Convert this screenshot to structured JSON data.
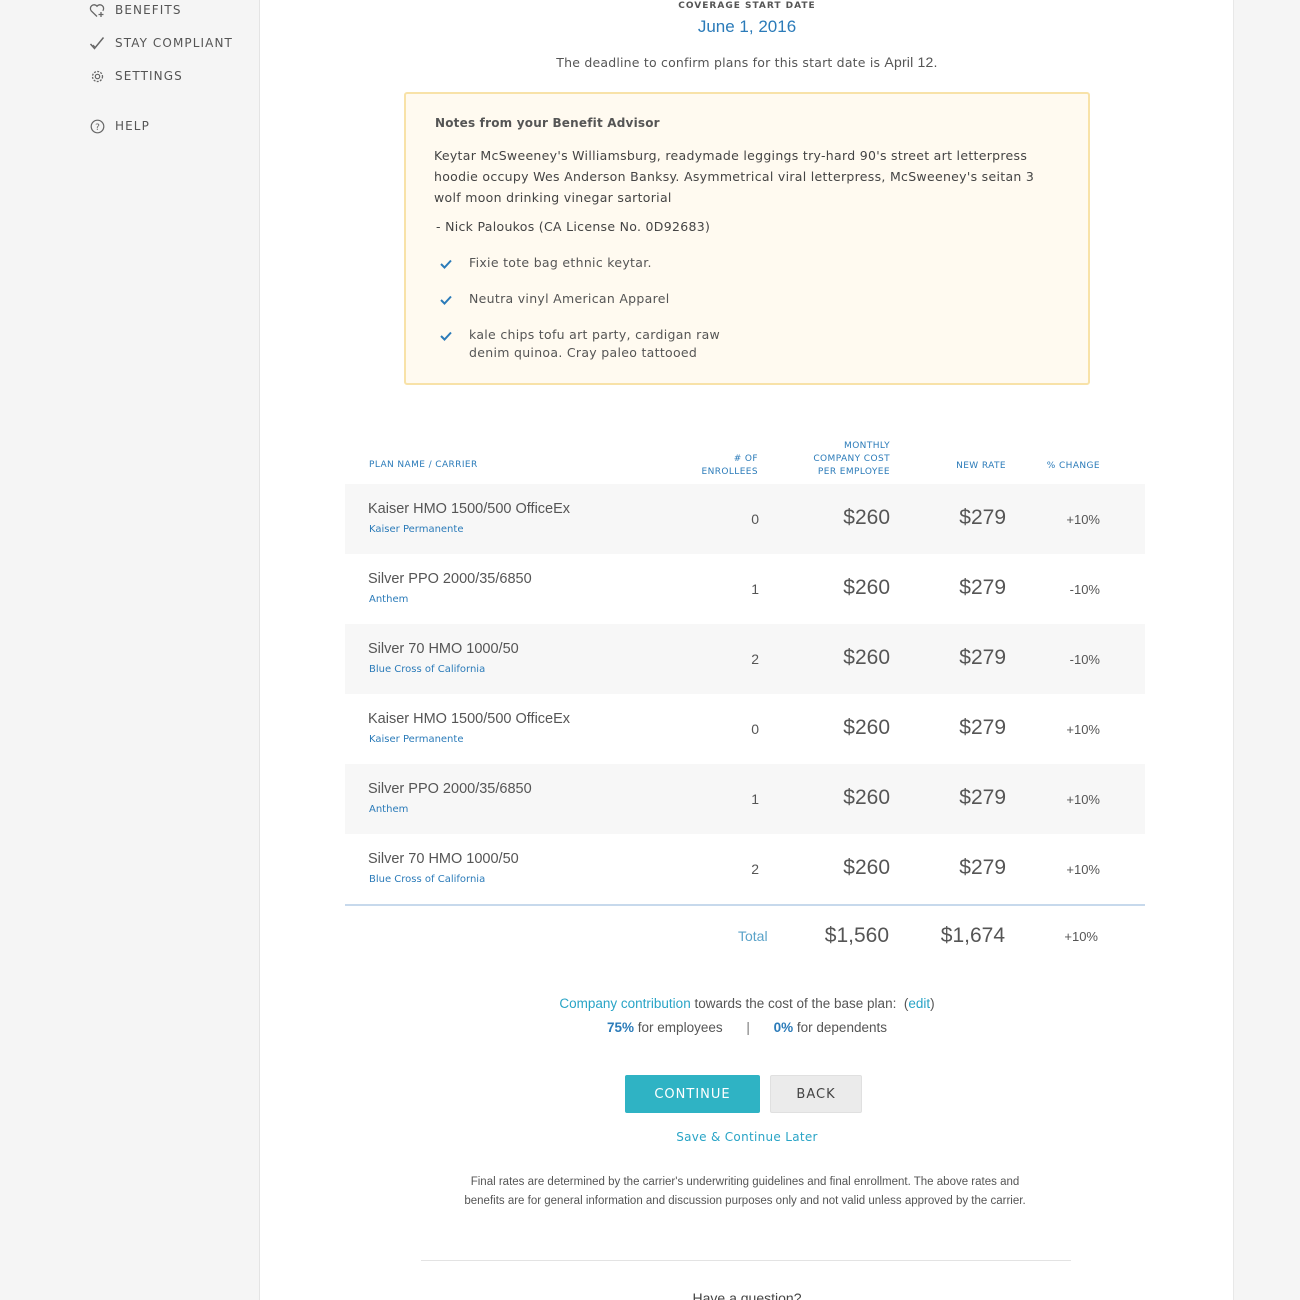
{
  "sidebar": {
    "items": [
      {
        "label": "BENEFITS",
        "icon": "heart-plus-icon"
      },
      {
        "label": "STAY COMPLIANT",
        "icon": "checkmark-icon"
      },
      {
        "label": "SETTINGS",
        "icon": "gear-icon"
      },
      {
        "label": "HELP",
        "icon": "question-circle-icon"
      }
    ]
  },
  "coverage": {
    "label": "COVERAGE START DATE",
    "date": "June 1, 2016",
    "deadline_text": "The deadline to confirm plans for this start date is",
    "deadline_date": "April 12",
    "deadline_end": "."
  },
  "notes": {
    "title": "Notes from your Benefit Advisor",
    "body": "Keytar McSweeney's Williamsburg, readymade leggings try-hard 90's street art letterpress hoodie occupy Wes Anderson Banksy. Asymmetrical viral letterpress, McSweeney's seitan 3 wolf moon drinking vinegar sartorial",
    "signature": "- Nick Paloukos (CA License No. 0D92683)",
    "checks": [
      "Fixie tote bag ethnic keytar.",
      "Neutra vinyl American Apparel",
      "kale chips tofu art party, cardigan raw denim quinoa. Cray paleo tattooed"
    ]
  },
  "table": {
    "headers": {
      "plan": "PLAN NAME / CARRIER",
      "enrollees_1": "# OF",
      "enrollees_2": "ENROLLEES",
      "cost_1": "MONTHLY",
      "cost_2": "COMPANY COST",
      "cost_3": "PER EMPLOYEE",
      "rate": "NEW RATE",
      "change": "% CHANGE"
    },
    "rows": [
      {
        "plan": "Kaiser HMO 1500/500 OfficeEx",
        "carrier": "Kaiser Permanente",
        "enrollees": "0",
        "cost": "$260",
        "rate": "$279",
        "change": "+10%"
      },
      {
        "plan": "Silver PPO 2000/35/6850",
        "carrier": "Anthem",
        "enrollees": "1",
        "cost": "$260",
        "rate": "$279",
        "change": "-10%"
      },
      {
        "plan": "Silver 70 HMO 1000/50",
        "carrier": "Blue Cross of California",
        "enrollees": "2",
        "cost": "$260",
        "rate": "$279",
        "change": "-10%"
      },
      {
        "plan": "Kaiser HMO 1500/500 OfficeEx",
        "carrier": "Kaiser Permanente",
        "enrollees": "0",
        "cost": "$260",
        "rate": "$279",
        "change": "+10%"
      },
      {
        "plan": "Silver PPO 2000/35/6850",
        "carrier": "Anthem",
        "enrollees": "1",
        "cost": "$260",
        "rate": "$279",
        "change": "+10%"
      },
      {
        "plan": "Silver 70 HMO 1000/50",
        "carrier": "Blue Cross of California",
        "enrollees": "2",
        "cost": "$260",
        "rate": "$279",
        "change": "+10%"
      }
    ],
    "total": {
      "label": "Total",
      "cost": "$1,560",
      "rate": "$1,674",
      "change": "+10%"
    }
  },
  "contribution": {
    "link": "Company contribution",
    "text": " towards the cost of the base plan:  (",
    "edit": "edit",
    "close": ")",
    "employees_pct": "75%",
    "employees_label": " for employees",
    "separator": "|",
    "dependents_pct": "0%",
    "dependents_label": " for dependents"
  },
  "actions": {
    "continue": "CONTINUE",
    "back": "BACK",
    "save_later": "Save & Continue Later"
  },
  "disclaimer": "Final rates are determined by the carrier's underwriting guidelines and final enrollment. The above rates and benefits are for general information and discussion purposes only and not valid unless approved by the carrier.",
  "question": "Have a question?",
  "colors": {
    "accent": "#2b7bb9",
    "teal": "#2fb3c4",
    "notes_bg": "#fffaf0",
    "notes_border": "#f8e2a8"
  }
}
